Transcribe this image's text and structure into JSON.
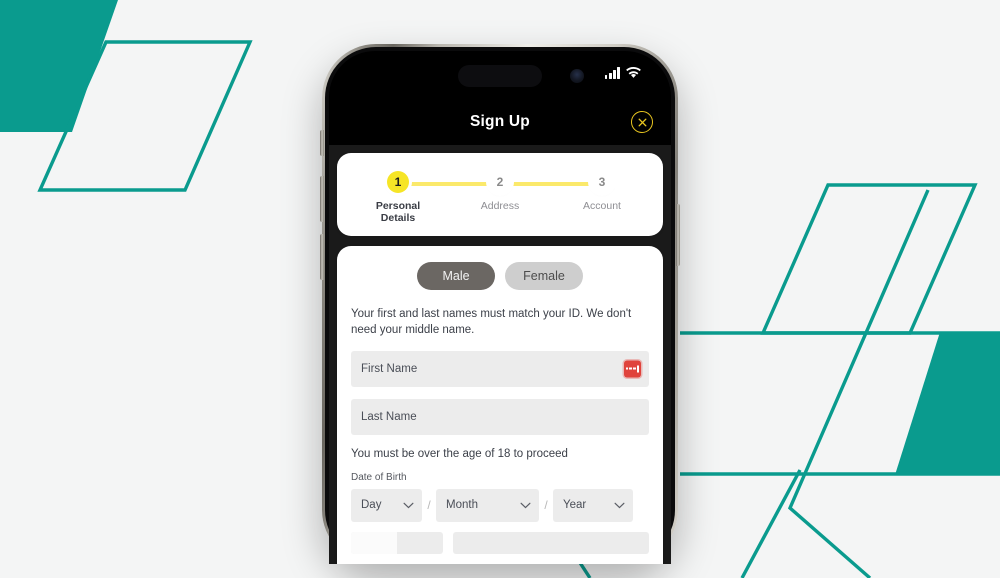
{
  "theme": {
    "teal": "#0a9b8e",
    "page_bg": "#f4f5f5",
    "accent_yellow": "#f6e526",
    "stepper_line": "#fbe96b",
    "error_red": "#e0433c"
  },
  "phone": {
    "status_bar": {
      "dynamic_island": "dynamic-island",
      "camera": "front-camera",
      "signal_icon": "cellular-signal-icon",
      "signal_bars": 4,
      "wifi_icon": "wifi-icon"
    },
    "title_bar": {
      "title": "Sign Up",
      "close_icon": "close-circle-icon"
    }
  },
  "stepper": {
    "steps": [
      {
        "number": "1",
        "label": "Personal Details",
        "active": true
      },
      {
        "number": "2",
        "label": "Address",
        "active": false
      },
      {
        "number": "3",
        "label": "Account",
        "active": false
      }
    ]
  },
  "form": {
    "gender": {
      "options": [
        {
          "label": "Male",
          "selected": true
        },
        {
          "label": "Female",
          "selected": false
        }
      ]
    },
    "name_help": "Your first and last names must match your ID. We don't need your middle name.",
    "first_name": {
      "placeholder": "First Name",
      "value": "",
      "icon": "error-indicator-icon"
    },
    "last_name": {
      "placeholder": "Last Name",
      "value": ""
    },
    "age_note": "You must be over the age of 18 to proceed",
    "dob": {
      "label": "Date of Birth",
      "separator": "/",
      "day": {
        "value": "Day",
        "chevron": "chevron-down-icon"
      },
      "month": {
        "value": "Month",
        "chevron": "chevron-down-icon"
      },
      "year": {
        "value": "Year",
        "chevron": "chevron-down-icon"
      }
    }
  }
}
